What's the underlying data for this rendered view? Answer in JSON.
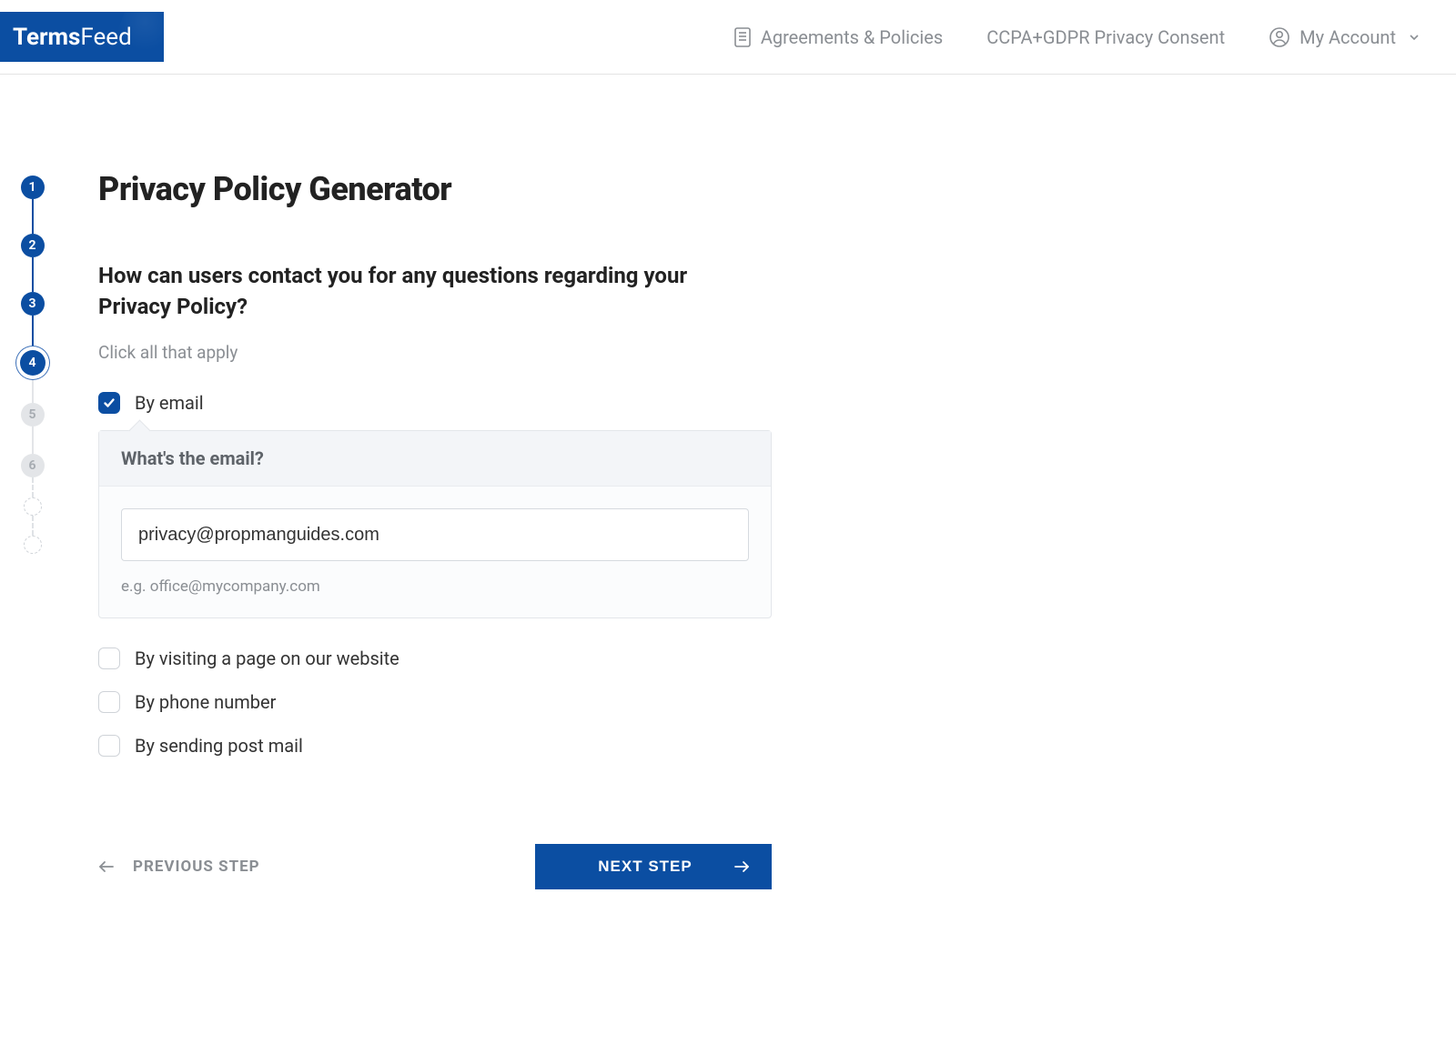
{
  "brand": {
    "bold": "Terms",
    "light": "Feed"
  },
  "nav": {
    "agreements": "Agreements & Policies",
    "ccpa": "CCPA+GDPR Privacy Consent",
    "account": "My Account"
  },
  "stepper": {
    "s1": "1",
    "s2": "2",
    "s3": "3",
    "s4": "4",
    "s5": "5",
    "s6": "6"
  },
  "page": {
    "title": "Privacy Policy Generator",
    "question": "How can users contact you for any questions regarding your Privacy Policy?",
    "hint": "Click all that apply"
  },
  "options": {
    "email": "By email",
    "page": "By visiting a page on our website",
    "phone": "By phone number",
    "mail": "By sending post mail"
  },
  "email_panel": {
    "header": "What's the email?",
    "value": "privacy@propmanguides.com",
    "example": "e.g. office@mycompany.com"
  },
  "actions": {
    "prev": "PREVIOUS STEP",
    "next": "NEXT STEP"
  }
}
